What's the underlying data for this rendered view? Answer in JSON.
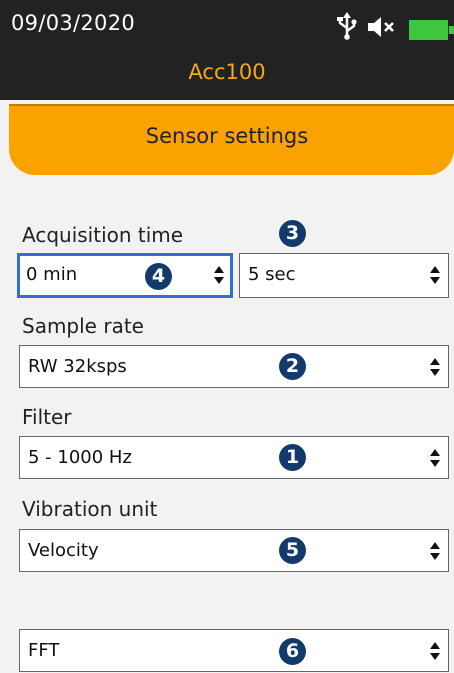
{
  "status": {
    "date": "09/03/2020",
    "device_name": "Acc100",
    "icons": [
      "usb-icon",
      "speaker-muted-icon",
      "battery-icon"
    ],
    "battery_color": "#3ec63e"
  },
  "header": {
    "title": "Sensor settings",
    "accent_color": "#f9a200"
  },
  "acquisition": {
    "label": "Acquisition time",
    "minutes_value": "0 min",
    "seconds_value": "5 sec",
    "minutes_badge": "4",
    "seconds_badge": "3"
  },
  "sample_rate": {
    "label": "Sample rate",
    "value": "RW 32ksps",
    "badge": "2"
  },
  "filter": {
    "label": "Filter",
    "value": "5 - 1000 Hz",
    "badge": "1"
  },
  "vibration_unit": {
    "label": "Vibration unit",
    "value": "Velocity",
    "badge": "5"
  },
  "analysis": {
    "value": "FFT",
    "badge": "6"
  }
}
